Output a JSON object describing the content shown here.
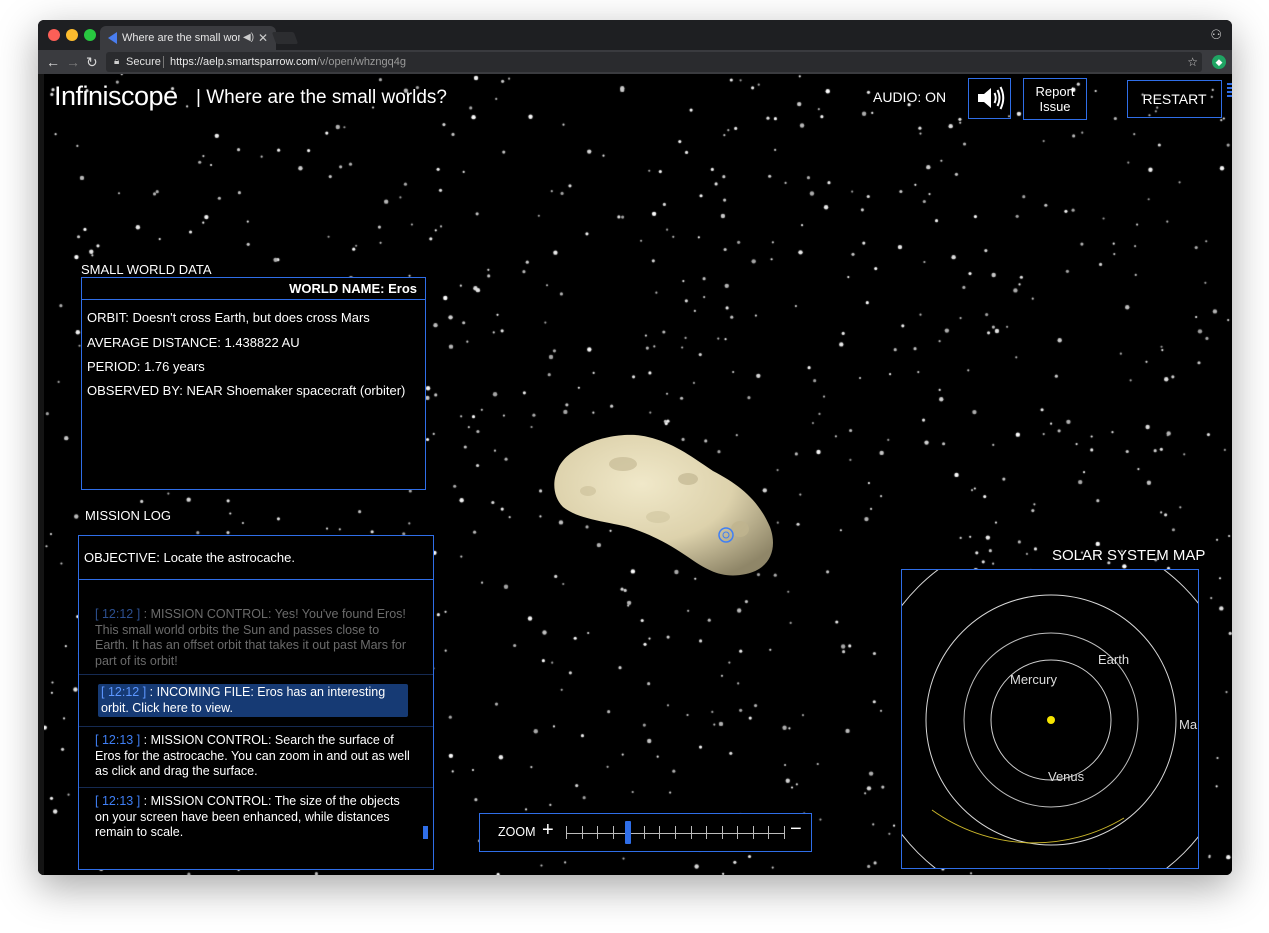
{
  "browser": {
    "tab_title": "Where are the small worlds",
    "secure_label": "Secure",
    "url_host": "https://aelp.smartsparrow.com",
    "url_path": "/v/open/whzngq4g"
  },
  "header": {
    "logo": "Infiniscope",
    "title": "| Where are the small worlds?",
    "audio_label": "AUDIO: ON",
    "report_label": "Report Issue",
    "restart_label": "RESTART"
  },
  "world_data": {
    "section_label": "SMALL WORLD DATA",
    "world_name": "WORLD NAME: Eros",
    "orbit": "ORBIT: Doesn't cross Earth, but does cross Mars",
    "average_distance": "AVERAGE DISTANCE: 1.438822 AU",
    "period": "PERIOD: 1.76 years",
    "observed_by": "OBSERVED BY: NEAR Shoemaker spacecraft (orbiter)"
  },
  "mission_log": {
    "section_label": "MISSION LOG",
    "objective": "OBJECTIVE: Locate the astrocache.",
    "entries": [
      {
        "time": "[ 12:12 ]",
        "text": " : MISSION CONTROL: Yes! You've found Eros! This small world orbits the Sun and passes close to Earth. It has an offset orbit that takes it out past Mars for part of its orbit!"
      },
      {
        "time": "[ 12:12 ]",
        "text": " : INCOMING FILE: Eros has an interesting orbit. Click here to view."
      },
      {
        "time": "[ 12:13 ]",
        "text": " : MISSION CONTROL: Search the surface of Eros for the astrocache. You can zoom in and out as well as click and drag the surface."
      },
      {
        "time": "[ 12:13 ]",
        "text": " : MISSION CONTROL: The size of the objects on your screen have been enhanced, while distances remain to scale."
      }
    ]
  },
  "zoom": {
    "label": "ZOOM",
    "plus": "+",
    "minus": "−",
    "steps": 15,
    "level": 4
  },
  "solar_map": {
    "section_label": "SOLAR SYSTEM MAP",
    "labels": {
      "earth": "Earth",
      "mercury": "Mercury",
      "venus": "Venus",
      "mars": "Ma"
    }
  },
  "colors": {
    "accent": "#2f6ee8",
    "timestamp": "#3f7ff5",
    "sun": "#f5e400",
    "asteroid_orbit": "#c9b52a"
  }
}
